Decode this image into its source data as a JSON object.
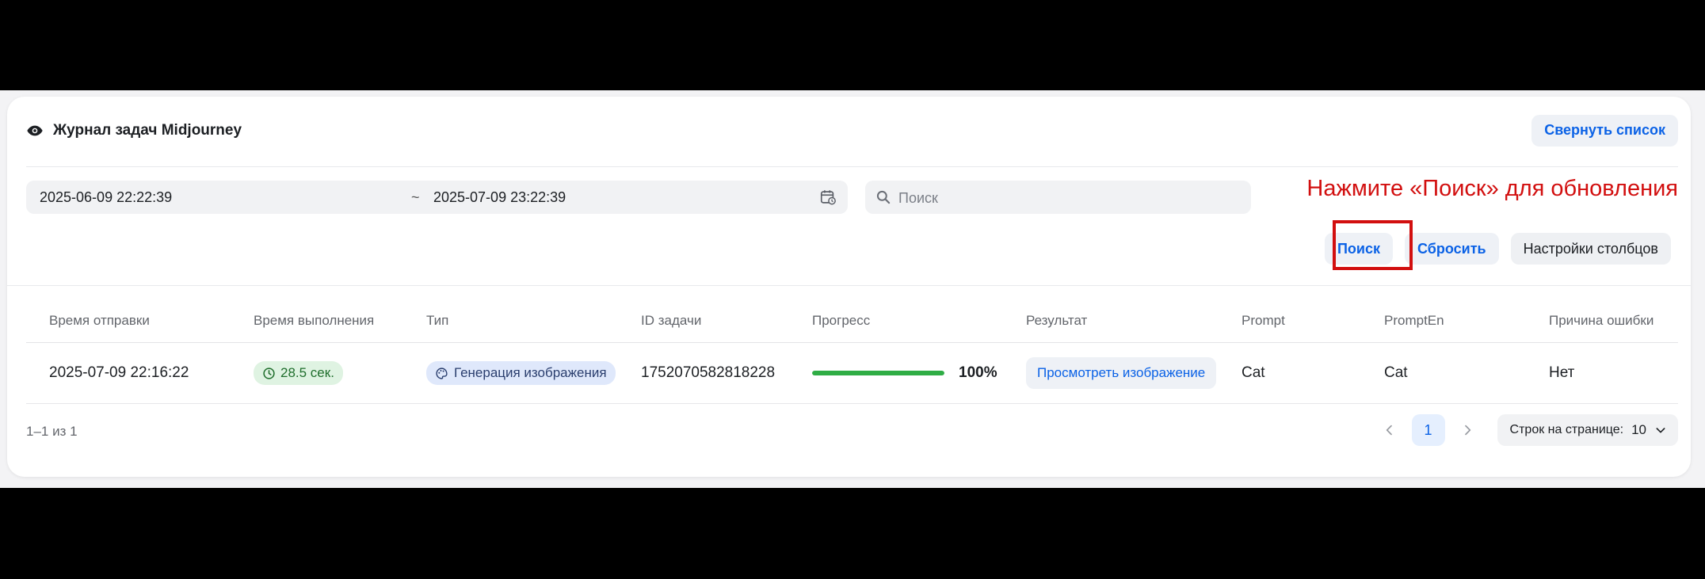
{
  "header": {
    "title": "Журнал задач Midjourney",
    "collapse_label": "Свернуть список"
  },
  "filters": {
    "date_start": "2025-06-09 22:22:39",
    "date_separator": "~",
    "date_end": "2025-07-09 23:22:39",
    "search_placeholder": "Поиск",
    "search_value": ""
  },
  "hint": "Нажмите «Поиск» для обновления",
  "actions": {
    "search_label": "Поиск",
    "reset_label": "Сбросить",
    "columns_label": "Настройки столбцов"
  },
  "table": {
    "columns": [
      "Время отправки",
      "Время выполнения",
      "Тип",
      "ID задачи",
      "Прогресс",
      "Результат",
      "Prompt",
      "PromptEn",
      "Причина ошибки"
    ],
    "rows": [
      {
        "submit_time": "2025-07-09 22:16:22",
        "duration": "28.5 сек.",
        "type": "Генерация изображения",
        "task_id": "1752070582818228",
        "progress": 100,
        "progress_label": "100%",
        "result_label": "Просмотреть изображение",
        "prompt": "Cat",
        "prompt_en": "Cat",
        "error": "Нет"
      }
    ]
  },
  "footer": {
    "range": "1–1 из 1",
    "current_page": "1",
    "rows_per_page_label": "Строк на странице:",
    "rows_per_page_value": "10"
  },
  "colors": {
    "accent": "#0b62e6",
    "hint": "#d20f0f",
    "progress": "#2fad45"
  },
  "icons": [
    "eye-icon",
    "calendar-icon",
    "search-icon",
    "clock-icon",
    "palette-icon",
    "chevron-left-icon",
    "chevron-right-icon",
    "chevron-down-icon"
  ]
}
